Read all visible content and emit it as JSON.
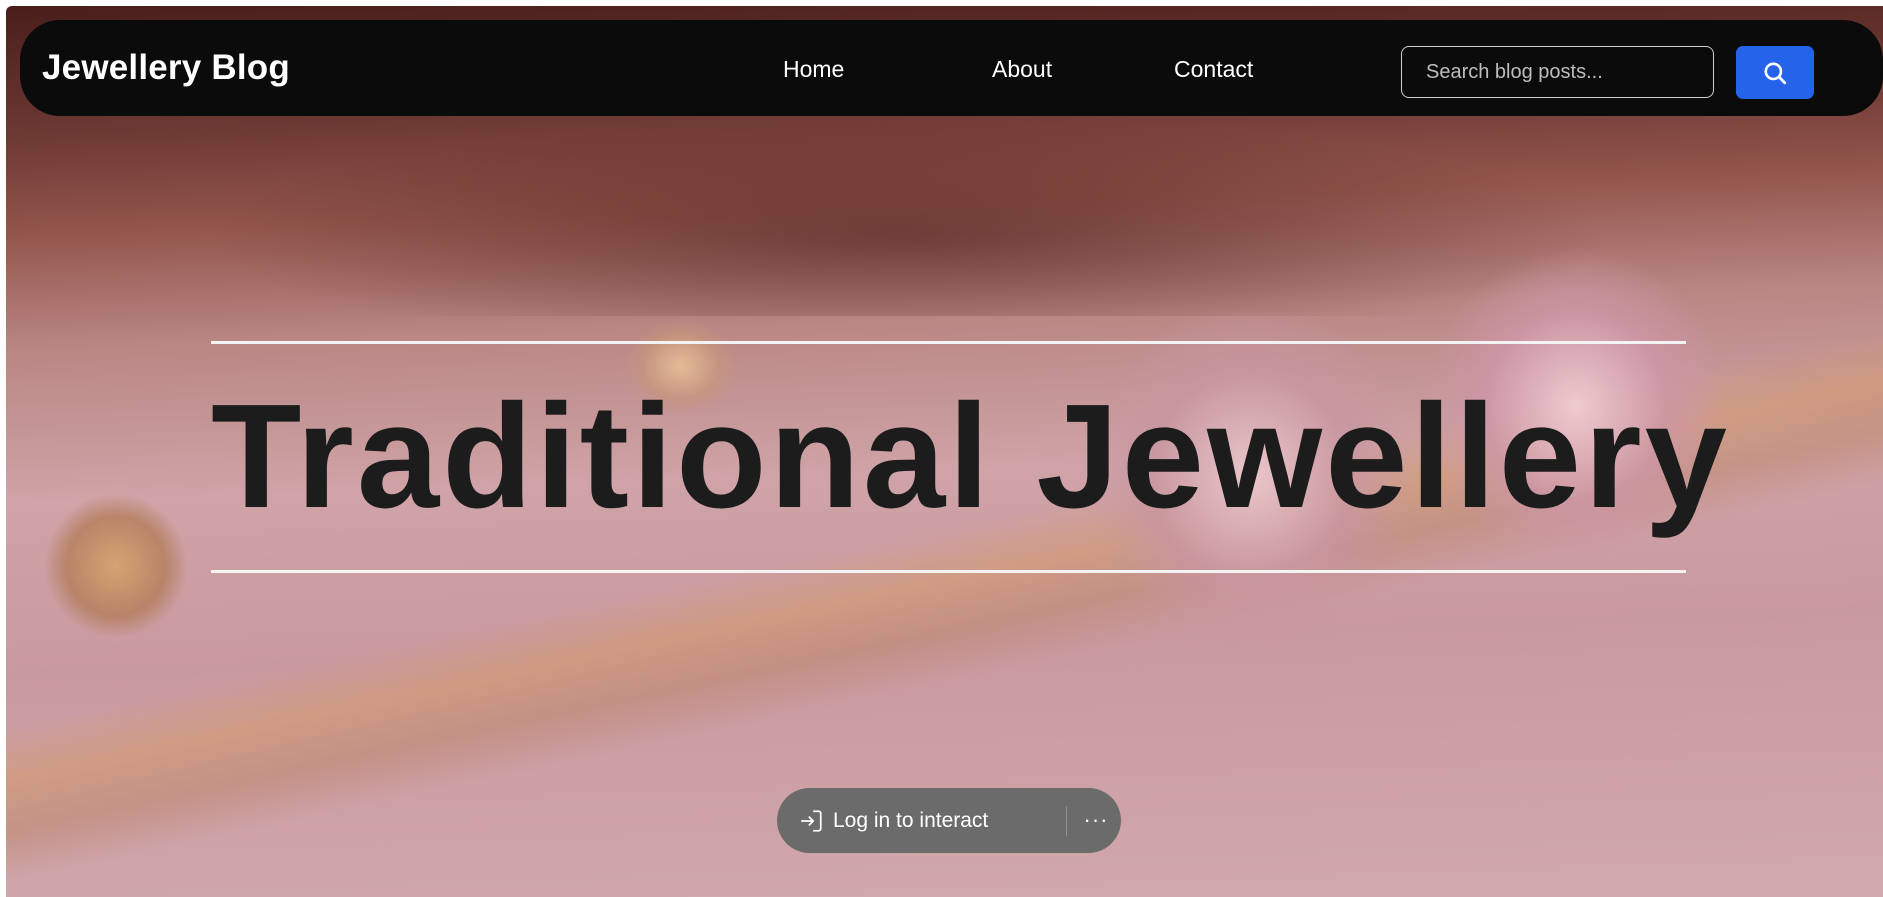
{
  "header": {
    "brand": "Jewellery Blog",
    "nav": [
      {
        "label": "Home"
      },
      {
        "label": "About"
      },
      {
        "label": "Contact"
      }
    ],
    "search": {
      "placeholder": "Search blog posts...",
      "value": "",
      "button_icon": "search-icon"
    }
  },
  "hero": {
    "title": "Traditional Jewellery",
    "background_image": "blurred-photo-of-pink-crystal-earrings-and-gold-chain"
  },
  "overlay": {
    "login_label": "Log in to interact",
    "login_icon": "sign-in-icon",
    "more_icon": "more-horizontal-icon",
    "more_glyph": "···"
  },
  "colors": {
    "navbar": "#0b0b0b",
    "accent": "#2563eb",
    "title": "#1c1c1c",
    "pill": "#6b6b6b"
  }
}
